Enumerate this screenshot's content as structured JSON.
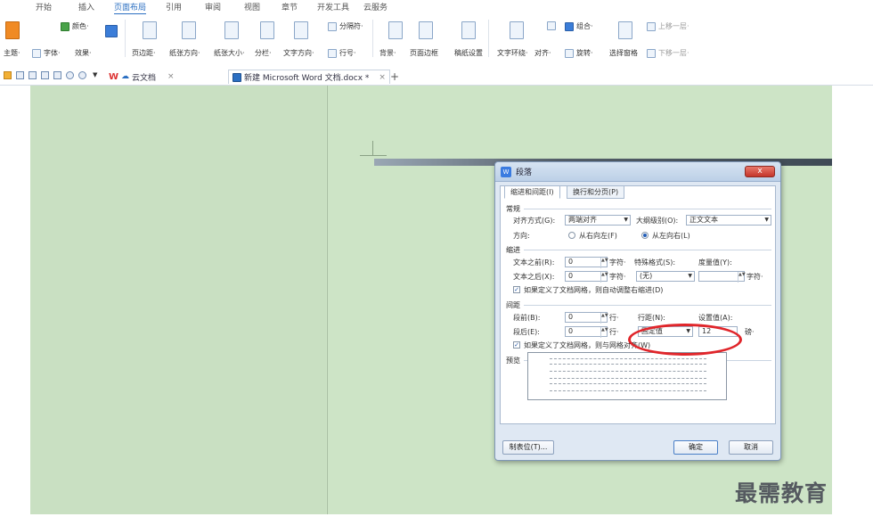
{
  "menu": {
    "items": [
      "开始",
      "插入",
      "页面布局",
      "引用",
      "审阅",
      "视图",
      "章节",
      "开发工具",
      "云服务"
    ],
    "active": "页面布局"
  },
  "ribbon": {
    "theme": "主题·",
    "colors": "颜色·",
    "fonts": "字体·",
    "effects": "效果·",
    "margins": "页边距·",
    "orientation": "纸张方向·",
    "size": "纸张大小·",
    "columns": "分栏·",
    "text_direction": "文字方向·",
    "breaks": "分隔符·",
    "line_numbers": "行号·",
    "background": "背景·",
    "page_border": "页面边框",
    "draft_settings": "稿纸设置",
    "wrap_text": "文字环绕·",
    "align": "对齐·",
    "group": "组合·",
    "rotate": "旋转·",
    "selection_pane": "选择窗格",
    "bring_forward": "上移一层·",
    "send_backward": "下移一层·"
  },
  "tabs": {
    "wps_tab": "云文档",
    "doc_tab": "新建 Microsoft Word 文档.docx *",
    "new_tab": "+"
  },
  "dialog": {
    "title": "段落",
    "close": "x",
    "tab1": "缩进和间距(I)",
    "tab2": "换行和分页(P)",
    "general": "常规",
    "alignment_label": "对齐方式(G):",
    "alignment_value": "两端对齐",
    "outline_label": "大纲级别(O):",
    "outline_value": "正文文本",
    "direction_label": "方向:",
    "rtl": "从右向左(F)",
    "ltr": "从左向右(L)",
    "indent": "缩进",
    "before_text_label": "文本之前(R):",
    "before_text_value": "0",
    "after_text_label": "文本之后(X):",
    "after_text_value": "0",
    "char_unit": "字符·",
    "special_label": "特殊格式(S):",
    "special_value": "(无)",
    "measure_label": "度量值(Y):",
    "auto_indent": "如果定义了文档网格，则自动调整右缩进(D)",
    "spacing": "间距",
    "before_label": "段前(B):",
    "before_value": "0",
    "after_label": "段后(E):",
    "after_value": "0",
    "line_unit": "行·",
    "line_spacing_label": "行距(N):",
    "line_spacing_value": "固定值",
    "set_value_label": "设置值(A):",
    "set_value": "12",
    "pt_unit": "磅·",
    "snap_grid": "如果定义了文档网格，则与网格对齐(W)",
    "preview": "预览",
    "tabs_button": "制表位(T)...",
    "ok": "确定",
    "cancel": "取消"
  },
  "watermark": "最需教育"
}
